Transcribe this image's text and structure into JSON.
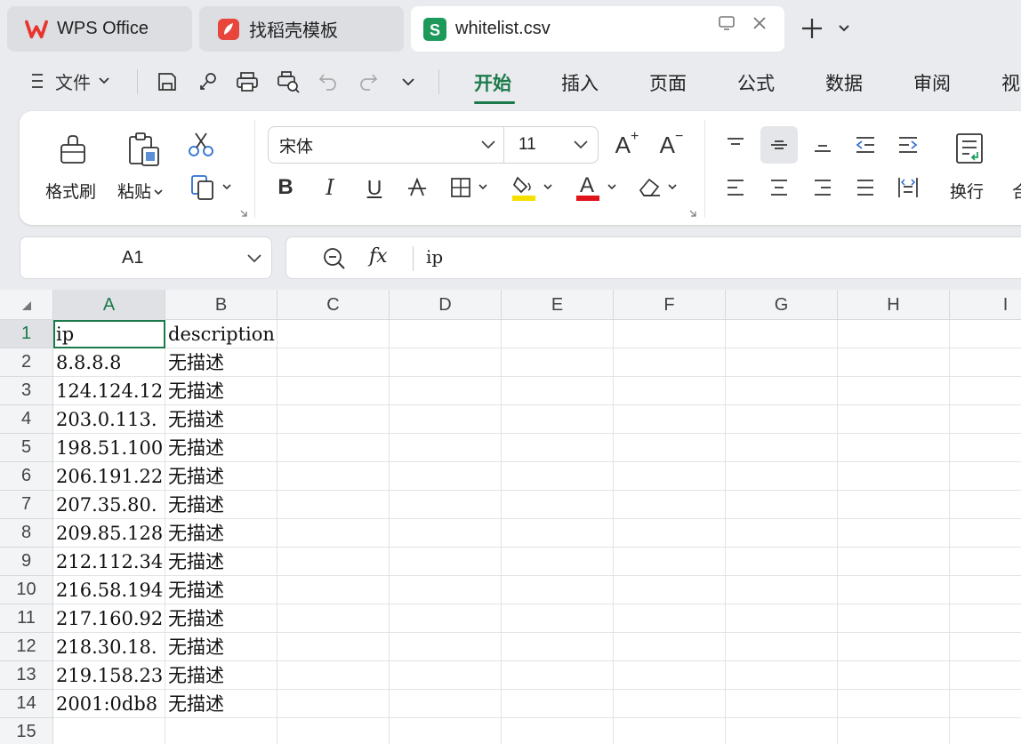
{
  "tabs": [
    {
      "label": "WPS Office",
      "icon": "wps-logo-icon",
      "active": false
    },
    {
      "label": "找稻壳模板",
      "icon": "docer-logo-icon",
      "active": false
    },
    {
      "label": "whitelist.csv",
      "icon": "spreadsheet-s-icon",
      "active": true
    }
  ],
  "spreadsheet_icon_letter": "S",
  "menu": {
    "file_label": "文件"
  },
  "ribbon_tabs": [
    "开始",
    "插入",
    "页面",
    "公式",
    "数据",
    "审阅",
    "视"
  ],
  "ribbon": {
    "format_painter": "格式刷",
    "paste": "粘贴",
    "font_name": "宋体",
    "font_size": "11",
    "bold": "B",
    "italic": "I",
    "underline": "U",
    "wrap": "换行",
    "merge_partial": "合",
    "increase_font": "A",
    "decrease_font": "A",
    "font_color_letter": "A"
  },
  "formula_bar": {
    "cell_ref": "A1",
    "fx": "fx",
    "content": "ip"
  },
  "columns": [
    "A",
    "B",
    "C",
    "D",
    "E",
    "F",
    "G",
    "H",
    "I"
  ],
  "rows": [
    {
      "n": "1",
      "a": "ip",
      "b": "description"
    },
    {
      "n": "2",
      "a": "8.8.8.8",
      "b": "无描述"
    },
    {
      "n": "3",
      "a": "124.124.12",
      "b": "无描述"
    },
    {
      "n": "4",
      "a": "203.0.113.",
      "b": "无描述"
    },
    {
      "n": "5",
      "a": "198.51.100",
      "b": "无描述"
    },
    {
      "n": "6",
      "a": "206.191.22",
      "b": "无描述"
    },
    {
      "n": "7",
      "a": "207.35.80.",
      "b": "无描述"
    },
    {
      "n": "8",
      "a": "209.85.128",
      "b": "无描述"
    },
    {
      "n": "9",
      "a": "212.112.34",
      "b": "无描述"
    },
    {
      "n": "10",
      "a": "216.58.194",
      "b": "无描述"
    },
    {
      "n": "11",
      "a": "217.160.92",
      "b": "无描述"
    },
    {
      "n": "12",
      "a": "218.30.18.",
      "b": "无描述"
    },
    {
      "n": "13",
      "a": "219.158.23",
      "b": "无描述"
    },
    {
      "n": "14",
      "a": "2001:0db8",
      "b": "无描述"
    },
    {
      "n": "15",
      "a": "",
      "b": ""
    }
  ],
  "colors": {
    "accent": "#1b7a4b",
    "wps_red": "#e8342e",
    "sheet_green": "#1d9a5a"
  }
}
